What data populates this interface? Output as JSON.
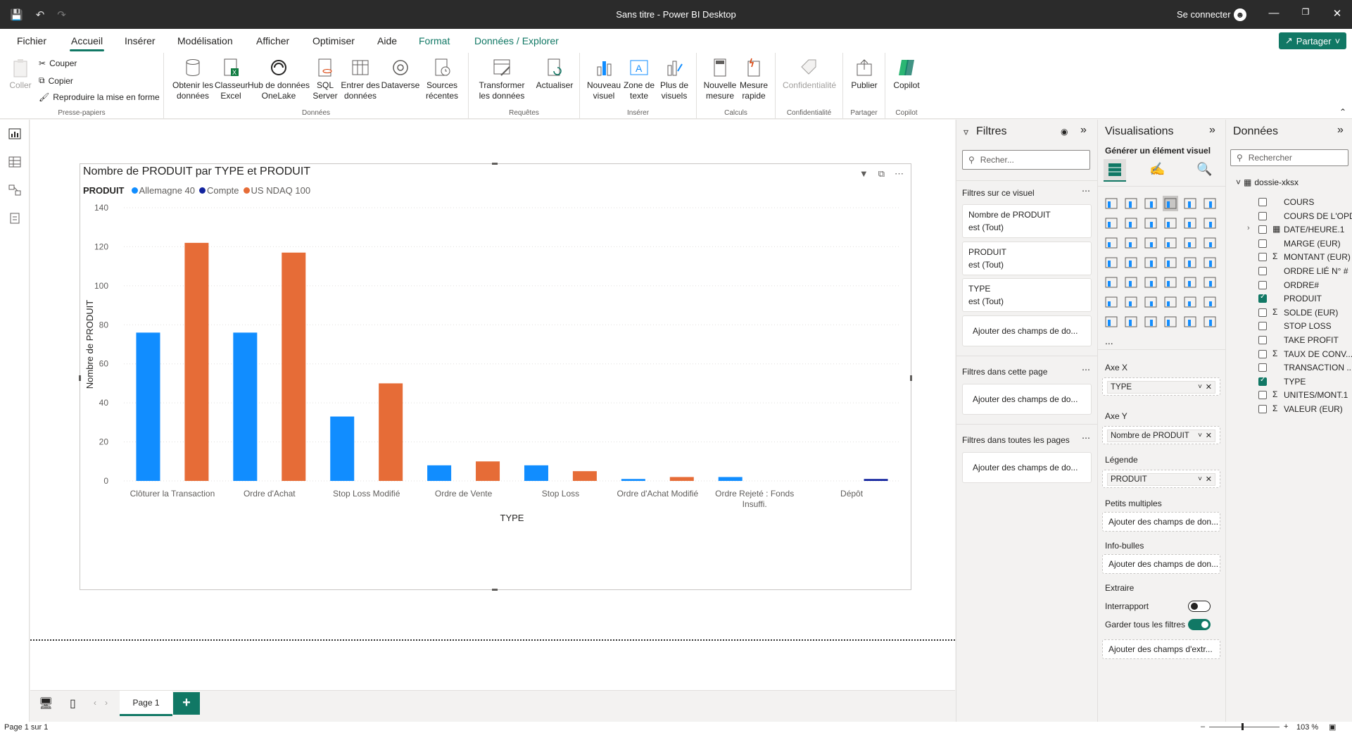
{
  "window": {
    "title": "Sans titre - Power BI Desktop",
    "signin": "Se connecter"
  },
  "menu": {
    "tabs": [
      "Fichier",
      "Accueil",
      "Insérer",
      "Modélisation",
      "Afficher",
      "Optimiser",
      "Aide",
      "Format",
      "Données / Explorer"
    ],
    "share": "Partager"
  },
  "ribbon": {
    "clipboard": {
      "paste": "Coller",
      "cut": "Couper",
      "copy": "Copier",
      "format_painter": "Reproduire la mise en forme",
      "group": "Presse-papiers"
    },
    "data": {
      "get_data": "Obtenir les données",
      "excel": "Classeur Excel",
      "onelake": "Hub de données OneLake",
      "sql": "SQL Server",
      "enter": "Entrer des données",
      "dataverse": "Dataverse",
      "recent": "Sources récentes",
      "group": "Données"
    },
    "queries": {
      "transform": "Transformer les données",
      "refresh": "Actualiser",
      "group": "Requêtes"
    },
    "insert": {
      "new_visual": "Nouveau visuel",
      "textbox": "Zone de texte",
      "more": "Plus de visuels",
      "group": "Insérer"
    },
    "calc": {
      "new_measure": "Nouvelle mesure",
      "quick_measure": "Mesure rapide",
      "group": "Calculs"
    },
    "sensitivity": {
      "label": "Confidentialité",
      "group": "Confidentialité"
    },
    "share": {
      "publish": "Publier",
      "group": "Partager"
    },
    "copilot": {
      "label": "Copilot",
      "group": "Copilot"
    }
  },
  "chart_data": {
    "type": "bar",
    "title": "Nombre de PRODUIT par TYPE et PRODUIT",
    "xlabel": "TYPE",
    "ylabel": "Nombre de PRODUIT",
    "legend_title": "PRODUIT",
    "legend_position": "top-left",
    "ylim": [
      0,
      140
    ],
    "yticks": [
      0,
      20,
      40,
      60,
      80,
      100,
      120,
      140
    ],
    "grid": true,
    "categories": [
      "Clôturer la Transaction",
      "Ordre d'Achat",
      "Stop Loss Modifié",
      "Ordre de Vente",
      "Stop Loss",
      "Ordre d'Achat Modifié",
      "Ordre Rejeté : Fonds Insuffi.",
      "Dépôt"
    ],
    "series": [
      {
        "name": "Allemagne 40",
        "color": "#118dff",
        "values": [
          76,
          76,
          33,
          8,
          8,
          1,
          2,
          0
        ]
      },
      {
        "name": "Compte",
        "color": "#12239e",
        "values": [
          0,
          0,
          0,
          0,
          0,
          0,
          0,
          1
        ]
      },
      {
        "name": "US NDAQ 100",
        "color": "#e66c37",
        "values": [
          122,
          117,
          50,
          10,
          5,
          2,
          0,
          0
        ]
      }
    ]
  },
  "pages": {
    "page1": "Page 1",
    "add": "+"
  },
  "status": {
    "page": "Page 1 sur 1",
    "zoom": "103 %"
  },
  "filters": {
    "title": "Filtres",
    "search": "Recher...",
    "on_visual": "Filtres sur ce visuel",
    "cards": [
      {
        "field": "Nombre de PRODUIT",
        "state": "est (Tout)"
      },
      {
        "field": "PRODUIT",
        "state": "est (Tout)"
      },
      {
        "field": "TYPE",
        "state": "est (Tout)"
      }
    ],
    "add_fields": "Ajouter des champs de do...",
    "on_page": "Filtres dans cette page",
    "on_all": "Filtres dans toutes les pages"
  },
  "viz": {
    "title": "Visualisations",
    "build": "Générer un élément visuel",
    "axis_x": "Axe X",
    "axis_x_value": "TYPE",
    "axis_y": "Axe Y",
    "axis_y_value": "Nombre de PRODUIT",
    "legend": "Légende",
    "legend_value": "PRODUIT",
    "small_multiples": "Petits multiples",
    "add_data": "Ajouter des champs de don...",
    "tooltips": "Info-bulles",
    "drillthrough": "Extraire",
    "cross_report": "Interrapport",
    "keep_filters": "Garder tous les filtres",
    "add_drill": "Ajouter des champs d'extr...",
    "more": "..."
  },
  "data": {
    "title": "Données",
    "search": "Rechercher",
    "table": "dossie-xksx",
    "fields": [
      {
        "name": "COURS",
        "sigma": false,
        "checked": false
      },
      {
        "name": "COURS DE L'OPD",
        "sigma": false,
        "checked": false
      },
      {
        "name": "DATE/HEURE.1",
        "sigma": false,
        "checked": false,
        "expandable": true
      },
      {
        "name": "MARGE (EUR)",
        "sigma": false,
        "checked": false
      },
      {
        "name": "MONTANT (EUR)",
        "sigma": true,
        "checked": false
      },
      {
        "name": "ORDRE LIÉ N° #",
        "sigma": false,
        "checked": false
      },
      {
        "name": "ORDRE#",
        "sigma": false,
        "checked": false
      },
      {
        "name": "PRODUIT",
        "sigma": false,
        "checked": true
      },
      {
        "name": "SOLDE (EUR)",
        "sigma": true,
        "checked": false
      },
      {
        "name": "STOP LOSS",
        "sigma": false,
        "checked": false
      },
      {
        "name": "TAKE PROFIT",
        "sigma": false,
        "checked": false
      },
      {
        "name": "TAUX DE CONV...",
        "sigma": true,
        "checked": false
      },
      {
        "name": "TRANSACTION ...",
        "sigma": false,
        "checked": false
      },
      {
        "name": "TYPE",
        "sigma": false,
        "checked": true
      },
      {
        "name": "UNITES/MONT.1",
        "sigma": true,
        "checked": false
      },
      {
        "name": "VALEUR (EUR)",
        "sigma": true,
        "checked": false
      }
    ]
  }
}
